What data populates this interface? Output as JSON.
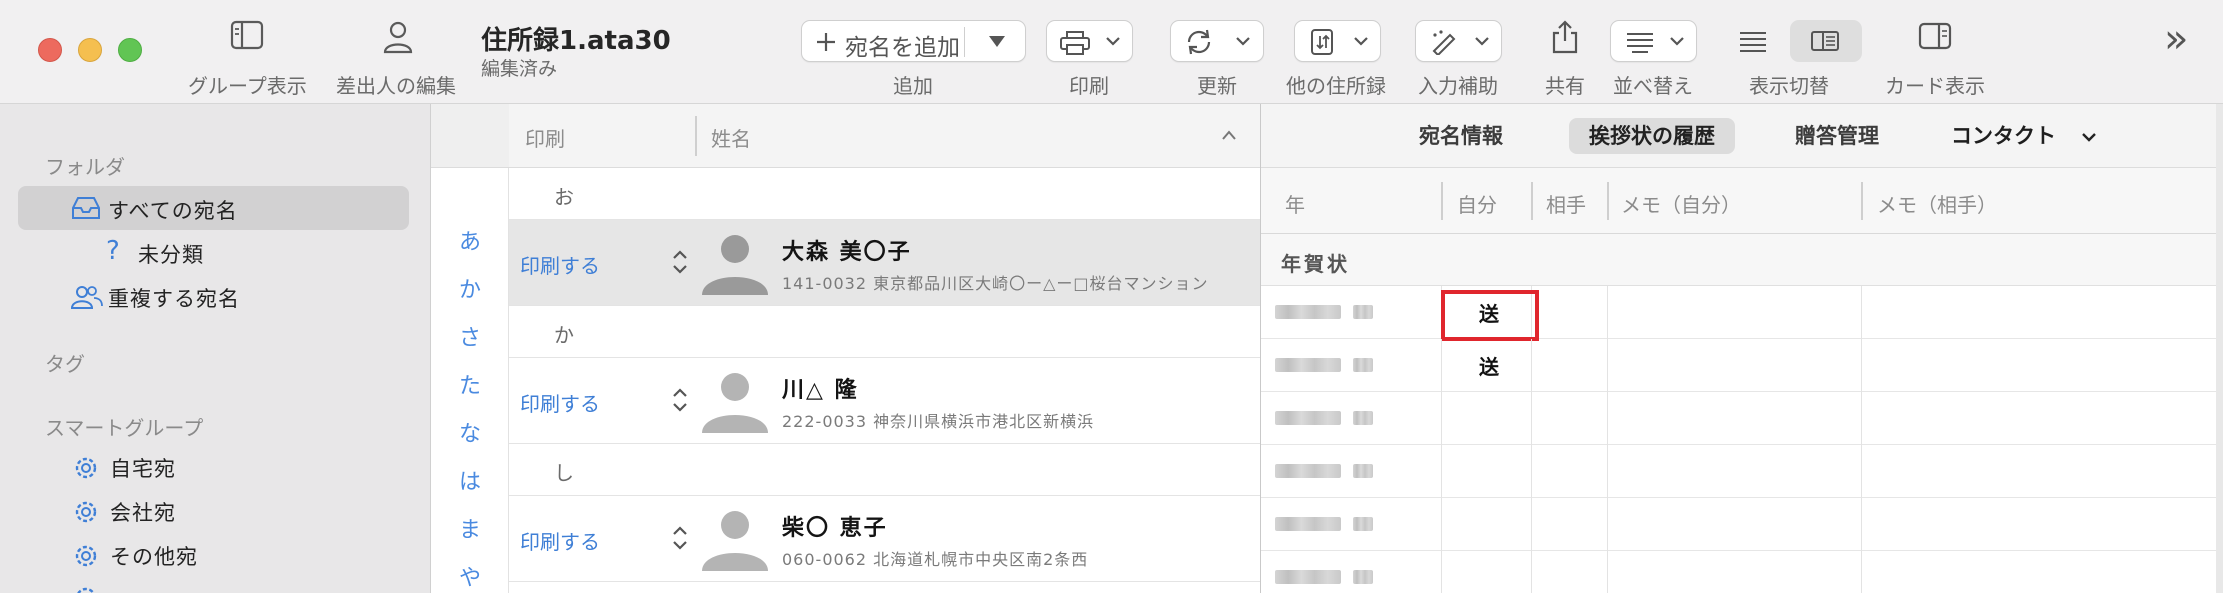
{
  "window": {
    "title": "住所録1.ata30",
    "subtitle": "編集済み"
  },
  "toolbar": {
    "group_view_label": "グループ表示",
    "sender_edit_label": "差出人の編集",
    "add_button_text": "宛名を追加",
    "add_label": "追加",
    "print_label": "印刷",
    "update_label": "更新",
    "other_book_label": "他の住所録",
    "input_assist_label": "入力補助",
    "share_label": "共有",
    "sort_label": "並べ替え",
    "view_switch_label": "表示切替",
    "card_view_label": "カード表示",
    "overflow_glyph": "»"
  },
  "sidebar": {
    "folder_header": "フォルダ",
    "items": [
      {
        "label": "すべての宛名",
        "icon": "tray-icon"
      },
      {
        "label": "未分類",
        "icon": "question-icon"
      },
      {
        "label": "重複する宛名",
        "icon": "people-icon"
      }
    ],
    "tag_header": "タグ",
    "smart_header": "スマートグループ",
    "smart_items": [
      {
        "label": "自宅宛",
        "icon": "gear-icon"
      },
      {
        "label": "会社宛",
        "icon": "gear-icon"
      },
      {
        "label": "その他宛",
        "icon": "gear-icon"
      }
    ]
  },
  "index": [
    "あ",
    "か",
    "さ",
    "た",
    "な",
    "は",
    "ま",
    "や"
  ],
  "list": {
    "col_print": "印刷",
    "col_name": "姓名",
    "sections": [
      {
        "label": "お"
      },
      {
        "label": "か"
      },
      {
        "label": "し"
      }
    ],
    "contacts": [
      {
        "print": "印刷する",
        "name": "大森 美〇子",
        "address": "141-0032 東京都品川区大崎〇ー△ー□桜台マンション"
      },
      {
        "print": "印刷する",
        "name": "川△ 隆",
        "address": "222-0033 神奈川県横浜市港北区新横浜"
      },
      {
        "print": "印刷する",
        "name": "柴〇 恵子",
        "address": "060-0062 北海道札幌市中央区南2条西"
      }
    ]
  },
  "detail": {
    "tabs": [
      "宛名情報",
      "挨拶状の履歴",
      "贈答管理"
    ],
    "active_tab": "挨拶状の履歴",
    "contact_menu": "コンタクト",
    "columns": {
      "year": "年",
      "self": "自分",
      "other": "相手",
      "memo_self": "メモ（自分）",
      "memo_other": "メモ（相手）"
    },
    "section": "年賀状",
    "rows": [
      {
        "self": "送"
      },
      {
        "self": "送"
      },
      {
        "self": ""
      },
      {
        "self": ""
      },
      {
        "self": ""
      },
      {
        "self": ""
      }
    ]
  },
  "colors": {
    "accent_blue": "#3f7fd6",
    "highlight_red": "#e0262d"
  }
}
